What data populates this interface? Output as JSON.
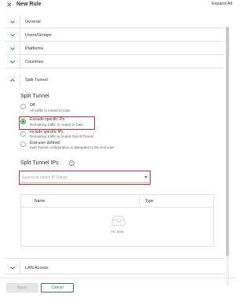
{
  "header": {
    "title": "New Rule",
    "expand_all": "Expand All"
  },
  "accordion": {
    "general": "General",
    "users_groups": "Users/Groups",
    "platforms": "Platforms",
    "countries": "Countries",
    "split_tunnel": "Split Tunnel",
    "lan_access": "LAN Access"
  },
  "split_tunnel": {
    "section_title": "Split Tunnel",
    "options": [
      {
        "label": "Off",
        "desc": "All traffic is routed to Cato",
        "selected": false
      },
      {
        "label": "Exclude specific IPs",
        "desc": "Remaining traffic is routed to Cato",
        "selected": true
      },
      {
        "label": "Include specific IPs",
        "desc": "Remaining traffic is routed Out-of-Tunnel",
        "selected": false
      },
      {
        "label": "End-user defined",
        "desc": "Split Tunnel configuration is delegated to the end-user",
        "selected": false
      }
    ],
    "ips_title": "Split Tunnel IPs",
    "help_glyph": "?",
    "ip_placeholder": "Search or select IP Range"
  },
  "table": {
    "columns": [
      "Name",
      "Type"
    ],
    "empty_text": "No data"
  },
  "footer": {
    "apply": "Apply",
    "cancel": "Cancel"
  },
  "colors": {
    "accent": "#2b8a3e",
    "highlight": "#d32f2f"
  }
}
